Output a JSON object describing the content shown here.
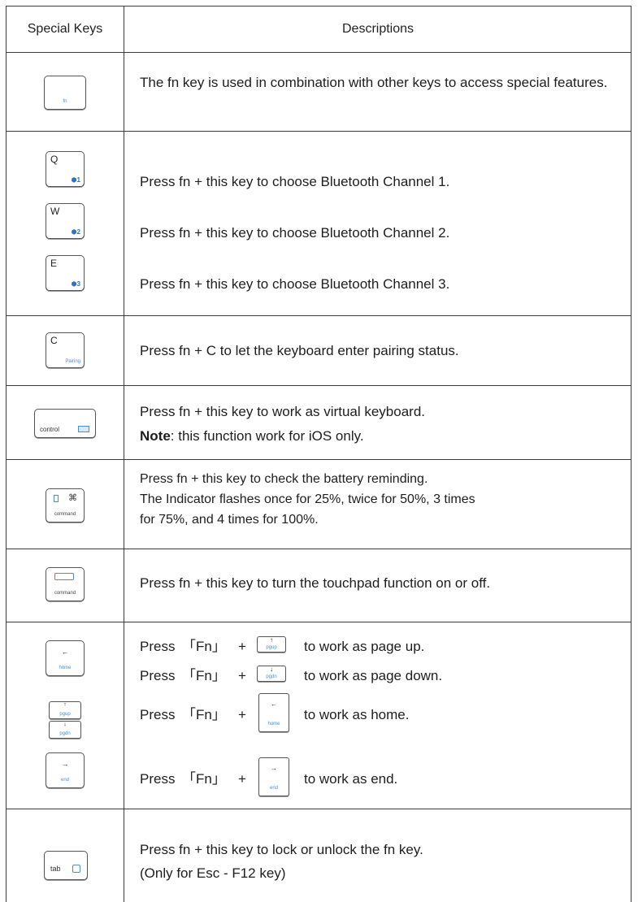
{
  "header": {
    "col_keys": "Special Keys",
    "col_desc": "Descriptions"
  },
  "rows": {
    "fn": {
      "key_label": "fn",
      "desc": "The fn key is used in combination with other keys to access special features."
    },
    "bt": {
      "keys": [
        {
          "main": "Q",
          "badge": "1"
        },
        {
          "main": "W",
          "badge": "2"
        },
        {
          "main": "E",
          "badge": "3"
        }
      ],
      "descs": [
        "Press fn + this key to choose Bluetooth Channel 1.",
        "Press fn + this key to choose Bluetooth Channel 2.",
        "Press fn + this key to choose Bluetooth Channel 3."
      ]
    },
    "pairing": {
      "main": "C",
      "sub": "Pairing",
      "desc": "Press fn + C to let the keyboard enter pairing status."
    },
    "control": {
      "main": "control",
      "desc1": "Press fn + this key to work as virtual keyboard.",
      "note_bold": "Note",
      "note_rest": ": this function work for iOS only."
    },
    "battery": {
      "mid": "⌘",
      "sub": "command",
      "lines": [
        "Press fn + this key to check the battery reminding.",
        "The Indicator flashes once for 25%, twice for 50%, 3 times",
        "for 75%, and 4 times for 100%."
      ]
    },
    "touchpad": {
      "sub": "command",
      "desc": "Press fn + this key to turn the touchpad function on or off."
    },
    "nav": {
      "keys": {
        "home": "home",
        "pgup": "pgup",
        "pgdn": "pgdn",
        "end": "end"
      },
      "press": "Press",
      "fn": "「Fn」",
      "plus": "+",
      "actions": [
        "to work as page up.",
        "to work as page down.",
        "to work as home.",
        "to work as end."
      ]
    },
    "tab": {
      "main": "tab",
      "desc1": "Press fn + this key to lock or unlock the fn key.",
      "desc2": "(Only for Esc - F12 key)"
    }
  }
}
